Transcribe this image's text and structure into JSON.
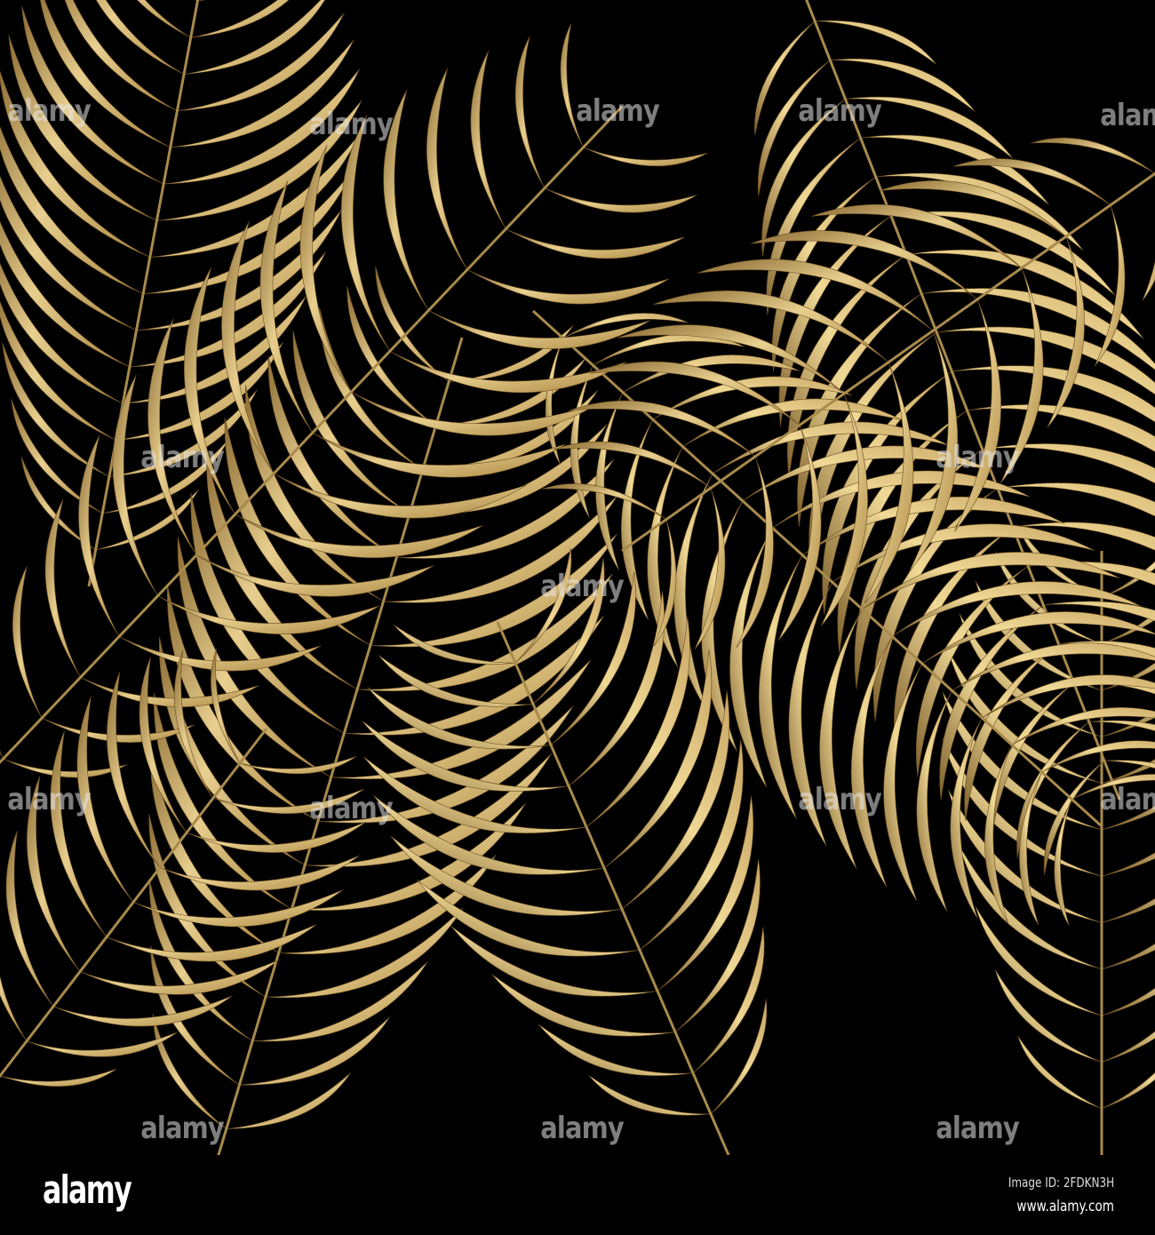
{
  "watermark": "alamy",
  "footer": {
    "logo": "alamy",
    "image_id": "Image ID: 2FDKN3H",
    "website": "www.alamy.com"
  },
  "colors": {
    "background": "#000000",
    "gold_light": "#e8cf8f",
    "gold_mid": "#c9a665",
    "gold_dark": "#8a6a32"
  }
}
